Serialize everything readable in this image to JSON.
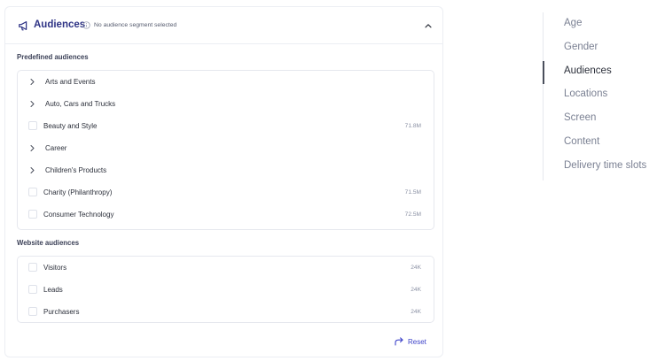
{
  "audiences_card": {
    "title": "Audiences",
    "subtitle": "No audience segment selected",
    "icon": "megaphone-icon"
  },
  "predefined": {
    "title": "Predefined audiences",
    "items": [
      {
        "label": "Arts and Events",
        "type": "expandable",
        "count": ""
      },
      {
        "label": "Auto, Cars and Trucks",
        "type": "expandable",
        "count": ""
      },
      {
        "label": "Beauty and Style",
        "type": "checkbox",
        "count": "71.8M"
      },
      {
        "label": "Career",
        "type": "expandable",
        "count": ""
      },
      {
        "label": "Children's Products",
        "type": "expandable",
        "count": ""
      },
      {
        "label": "Charity (Philanthropy)",
        "type": "checkbox",
        "count": "71.5M"
      },
      {
        "label": "Consumer Technology",
        "type": "checkbox",
        "count": "72.5M"
      }
    ]
  },
  "website": {
    "title": "Website audiences",
    "items": [
      {
        "label": "Visitors",
        "count": "24K"
      },
      {
        "label": "Leads",
        "count": "24K"
      },
      {
        "label": "Purchasers",
        "count": "24K"
      }
    ]
  },
  "reset_label": "Reset",
  "side_nav": {
    "items": [
      "Age",
      "Gender",
      "Audiences",
      "Locations",
      "Screen",
      "Content",
      "Delivery time slots"
    ],
    "active": "Audiences"
  },
  "colors": {
    "accent": "#3d42c9",
    "title": "#2e3385",
    "border": "#eceef3"
  }
}
